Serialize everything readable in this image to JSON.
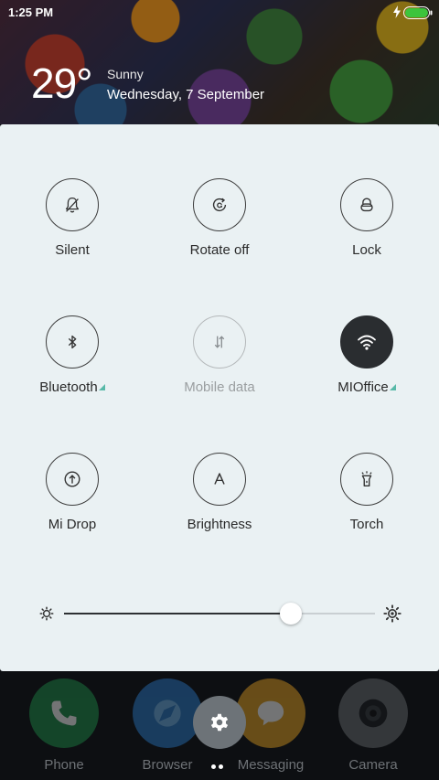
{
  "status_bar": {
    "time": "1:25 PM",
    "battery_icon": "battery-full-icon",
    "charging_icon": "charging-bolt-icon",
    "battery_color": "#3cc43c"
  },
  "weather": {
    "temperature": "29°",
    "condition": "Sunny",
    "date": "Wednesday, 7 September"
  },
  "quick_settings": {
    "panel_color": "#eaf1f3",
    "tiles": [
      {
        "label": "Silent",
        "icon": "bell-off-icon",
        "state": "off"
      },
      {
        "label": "Rotate off",
        "icon": "rotate-lock-icon",
        "state": "off"
      },
      {
        "label": "Lock",
        "icon": "lock-icon",
        "state": "off"
      },
      {
        "label": "Bluetooth",
        "icon": "bluetooth-icon",
        "state": "off",
        "has_submenu": true
      },
      {
        "label": "Mobile data",
        "icon": "mobile-data-icon",
        "state": "disabled"
      },
      {
        "label": "MIOffice",
        "icon": "wifi-icon",
        "state": "on",
        "has_submenu": true
      },
      {
        "label": "Mi Drop",
        "icon": "mi-drop-icon",
        "state": "off"
      },
      {
        "label": "Brightness",
        "icon": "brightness-auto-icon",
        "state": "off"
      },
      {
        "label": "Torch",
        "icon": "torch-icon",
        "state": "off"
      }
    ],
    "brightness": {
      "level": 0.73,
      "low_icon": "brightness-low-icon",
      "high_icon": "brightness-high-icon"
    },
    "accent_color": "#58b9a8"
  },
  "dock": {
    "apps": [
      {
        "label": "Phone",
        "icon": "phone-icon",
        "color": "#1f8f4a"
      },
      {
        "label": "Browser",
        "icon": "browser-icon",
        "color": "#2a7ac8"
      },
      {
        "label": "Messaging",
        "icon": "message-icon",
        "color": "#e6a321"
      },
      {
        "label": "Camera",
        "icon": "camera-icon",
        "color": "#6b6f73"
      }
    ],
    "settings_icon": "gear-icon"
  }
}
